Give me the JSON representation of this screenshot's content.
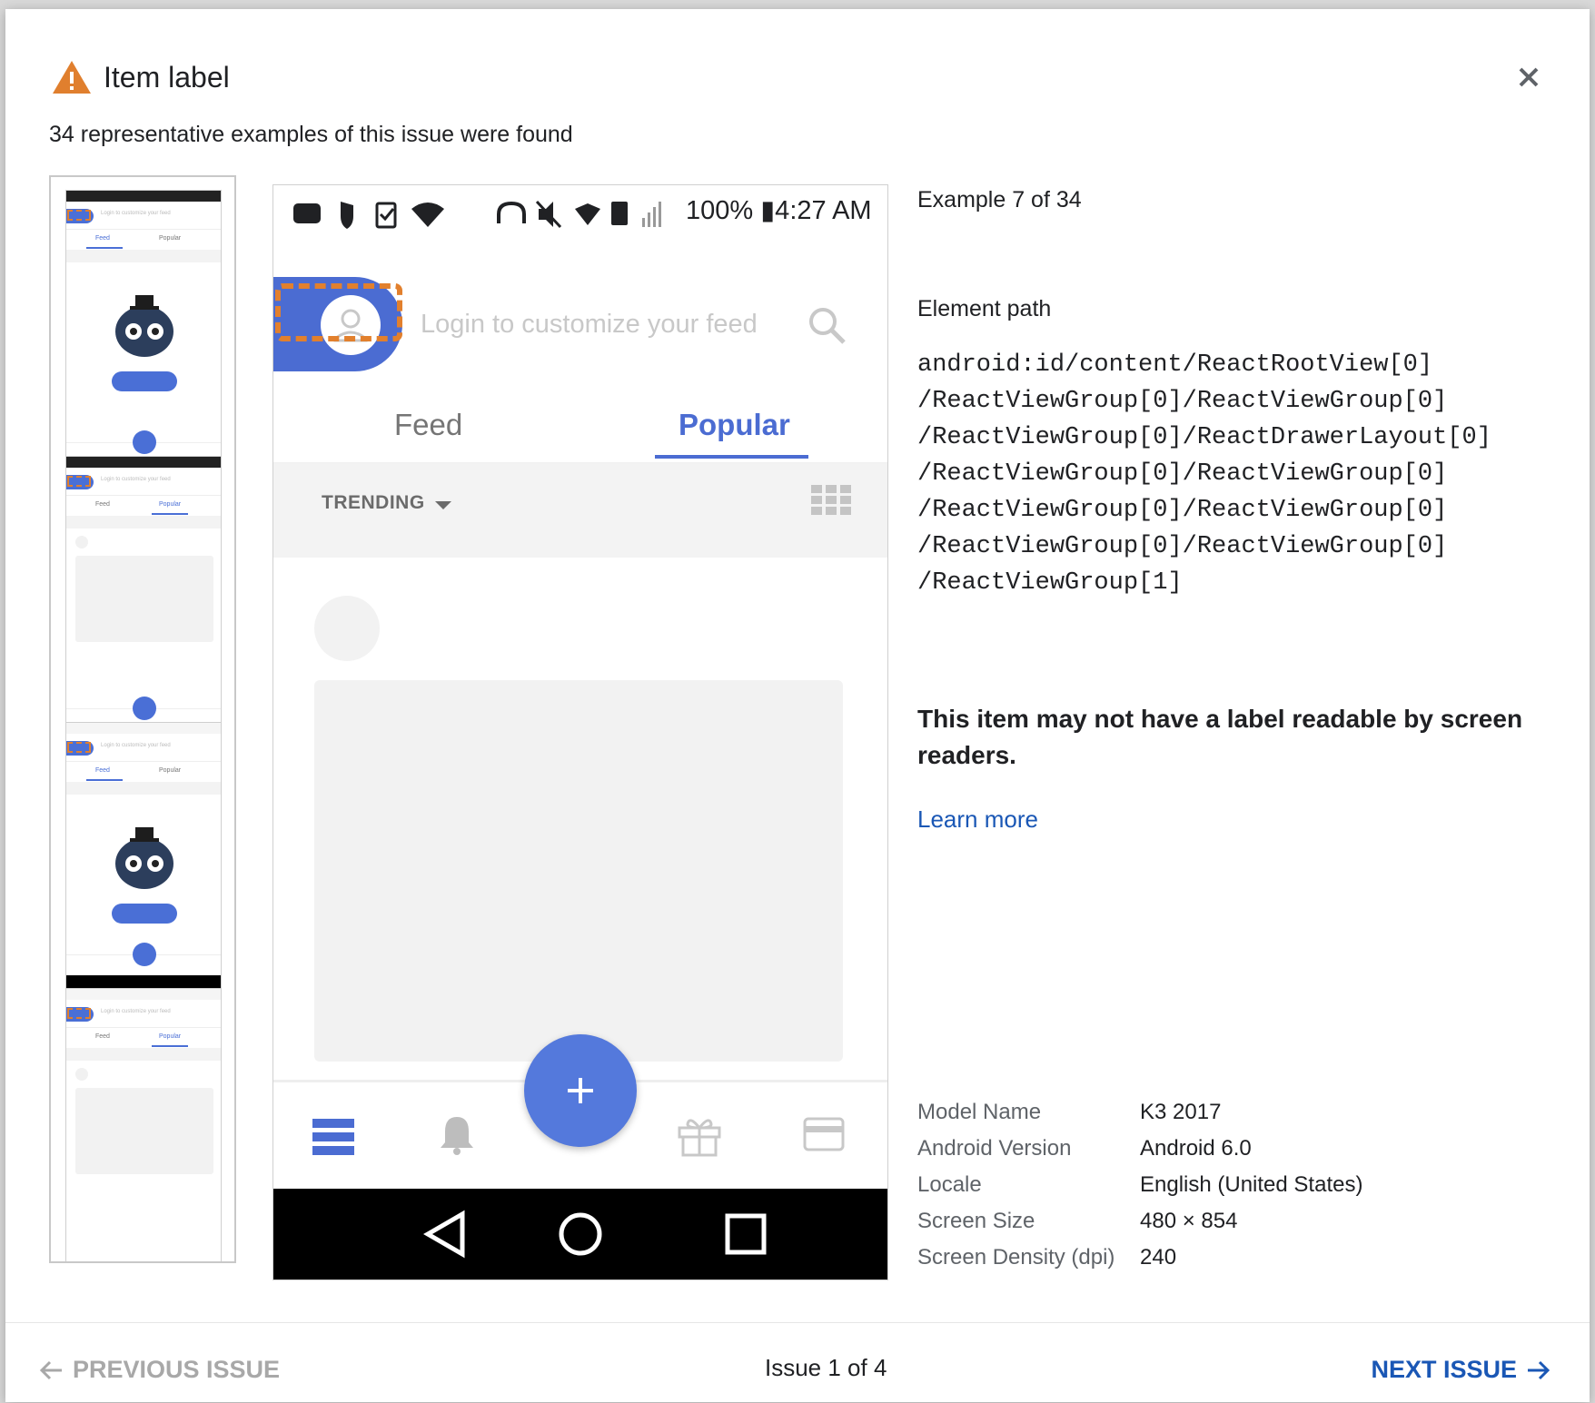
{
  "dialog": {
    "title": "Item label",
    "subtitle": "34 representative examples of this issue were found"
  },
  "preview": {
    "status_text": "100% ▮4:27 AM",
    "search_placeholder": "Login to customize your feed",
    "tabs": [
      {
        "label": "Feed"
      },
      {
        "label": "Popular"
      }
    ],
    "filter_label": "TRENDING"
  },
  "thumbnails": [
    {
      "search_text": "Login to customize your feed",
      "tab_feed": "Feed",
      "tab_popular": "Popular"
    },
    {
      "search_text": "Login to customize your feed",
      "tab_feed": "Feed",
      "tab_popular": "Popular"
    },
    {
      "search_text": "Login to customize your feed",
      "tab_feed": "Feed",
      "tab_popular": "Popular"
    },
    {
      "search_text": "Login to customize your feed",
      "tab_feed": "Feed",
      "tab_popular": "Popular"
    }
  ],
  "details": {
    "example_count": "Example 7 of 34",
    "path_label": "Element path",
    "path_lines": [
      "android:id/content/ReactRootView[0]",
      "/ReactViewGroup[0]/ReactViewGroup[0]",
      "/ReactViewGroup[0]/ReactDrawerLayout[0]",
      "/ReactViewGroup[0]/ReactViewGroup[0]",
      "/ReactViewGroup[0]/ReactViewGroup[0]",
      "/ReactViewGroup[0]/ReactViewGroup[0]",
      "/ReactViewGroup[1]"
    ],
    "message": "This item may not have a label readable by screen readers.",
    "learn_more": "Learn more",
    "device": [
      {
        "key": "Model Name",
        "value": "K3 2017"
      },
      {
        "key": "Android Version",
        "value": "Android 6.0"
      },
      {
        "key": "Locale",
        "value": "English (United States)"
      },
      {
        "key": "Screen Size",
        "value": "480 × 854"
      },
      {
        "key": "Screen Density (dpi)",
        "value": "240"
      }
    ]
  },
  "footer": {
    "previous": "PREVIOUS ISSUE",
    "issue_count": "Issue 1 of 4",
    "next": "NEXT ISSUE"
  },
  "colors": {
    "warning": "#e07f2e",
    "accent": "#4b6cd2",
    "link": "#1a57b5"
  }
}
